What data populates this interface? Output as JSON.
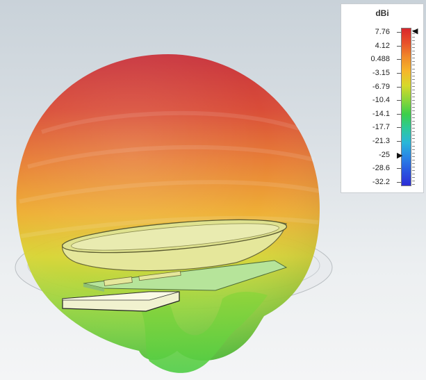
{
  "legend": {
    "unit": "dBi",
    "ticks": [
      "7.76",
      "4.12",
      "0.488",
      "-3.15",
      "-6.79",
      "-10.4",
      "-14.1",
      "-17.7",
      "-21.3",
      "-25",
      "-28.6",
      "-32.2"
    ],
    "markers": [
      "max-marker",
      "min-marker"
    ],
    "colorscale": [
      "#d9262b",
      "#e8502a",
      "#f08a2a",
      "#f6b62a",
      "#d6d92a",
      "#8cd63a",
      "#3ccf4a",
      "#2cc99a",
      "#2ab6d9",
      "#2a86e6",
      "#2a56e0",
      "#2d2dd6"
    ]
  },
  "scene": {
    "background": "#dde3e7",
    "pattern_top_color": "#c8353a",
    "pattern_bottom_color": "#5ccf3e",
    "antenna_color": "#e6e8a0"
  }
}
